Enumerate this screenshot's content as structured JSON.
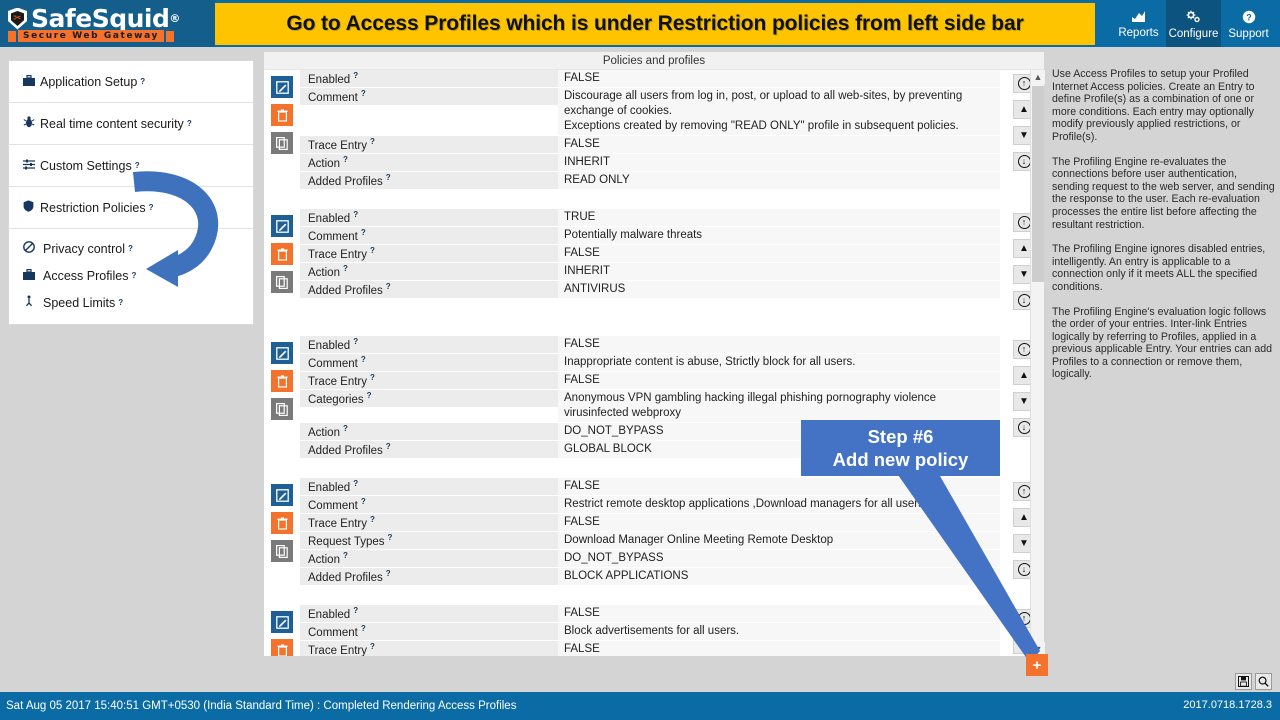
{
  "app": {
    "brand": "SafeSquid",
    "brand_reg": "®",
    "tagline": "Secure Web Gateway"
  },
  "banner": {
    "text": "Go to  Access Profiles which is under Restriction policies from left side bar",
    "bg": "#ffc400"
  },
  "topnav": [
    {
      "label": "Reports",
      "icon": "chart-icon",
      "glyph": "ὌA",
      "active": false
    },
    {
      "label": "Configure",
      "icon": "gear-icon",
      "glyph": "⚙",
      "active": true
    },
    {
      "label": "Support",
      "icon": "question-icon",
      "glyph": "❓",
      "active": false
    }
  ],
  "sidebar": {
    "items": [
      {
        "label": "Application Setup",
        "icon": "briefcase-icon",
        "glyph": "ὋC"
      },
      {
        "label": "Real time content security",
        "icon": "bug-icon",
        "glyph": "ὁE"
      },
      {
        "label": "Custom Settings",
        "icon": "sliders-icon",
        "glyph": "☲"
      },
      {
        "label": "Restriction Policies",
        "icon": "shield-icon",
        "glyph": "Ὦ1"
      }
    ],
    "subitems": [
      {
        "label": "Privacy control",
        "icon": "no-entry-icon",
        "glyph": "⃠"
      },
      {
        "label": "Access Profiles",
        "icon": "briefcase-icon",
        "glyph": "ὋC"
      },
      {
        "label": "Speed Limits",
        "icon": "gauge-icon",
        "glyph": "↧"
      }
    ],
    "help_marker": "?"
  },
  "main": {
    "header": "Policies and profiles",
    "entries": [
      {
        "rows": [
          {
            "label": "Enabled",
            "value": "FALSE"
          },
          {
            "label": "Comment",
            "value": "Discourage all users from log in, post, or upload to all web-sites, by preventing exchange of cookies.\nExceptions created by removing \"READ ONLY\" profile in subsequent policies."
          },
          {
            "label": "Trace Entry",
            "value": "FALSE"
          },
          {
            "label": "Action",
            "value": "INHERIT"
          },
          {
            "label": "Added Profiles",
            "value": "READ ONLY"
          }
        ]
      },
      {
        "rows": [
          {
            "label": "Enabled",
            "value": "TRUE"
          },
          {
            "label": "Comment",
            "value": "Potentially malware threats"
          },
          {
            "label": "Trace Entry",
            "value": "FALSE"
          },
          {
            "label": "Action",
            "value": "INHERIT"
          },
          {
            "label": "Added Profiles",
            "value": "ANTIVIRUS"
          }
        ]
      },
      {
        "rows": [
          {
            "label": "Enabled",
            "value": "FALSE"
          },
          {
            "label": "Comment",
            "value": "Inappropriate content is abuse, Strictly block for all users."
          },
          {
            "label": "Trace Entry",
            "value": "FALSE"
          },
          {
            "label": "Categories",
            "value": "Anonymous VPN  gambling  hacking  illegal  phishing  pornography  violence  virusinfected  webproxy"
          },
          {
            "label": "Action",
            "value": "DO_NOT_BYPASS"
          },
          {
            "label": "Added Profiles",
            "value": "GLOBAL BLOCK"
          }
        ]
      },
      {
        "rows": [
          {
            "label": "Enabled",
            "value": "FALSE"
          },
          {
            "label": "Comment",
            "value": "Restrict remote desktop applications ,Download managers for all users."
          },
          {
            "label": "Trace Entry",
            "value": "FALSE"
          },
          {
            "label": "Request Types",
            "value": "Download Manager  Online Meeting  Remote Desktop"
          },
          {
            "label": "Action",
            "value": "DO_NOT_BYPASS"
          },
          {
            "label": "Added Profiles",
            "value": "BLOCK APPLICATIONS"
          }
        ]
      },
      {
        "rows": [
          {
            "label": "Enabled",
            "value": "FALSE"
          },
          {
            "label": "Comment",
            "value": "Block advertisements for all users."
          },
          {
            "label": "Trace Entry",
            "value": "FALSE"
          }
        ]
      }
    ],
    "entry_actions": [
      {
        "name": "edit",
        "glyph": "✎"
      },
      {
        "name": "delete",
        "glyph": "Ὕ1"
      },
      {
        "name": "copy",
        "glyph": "⧉"
      }
    ],
    "entry_controls": [
      {
        "name": "insert-above",
        "glyph": "↑"
      },
      {
        "name": "move-up",
        "glyph": "▲"
      },
      {
        "name": "move-down",
        "glyph": "▼"
      },
      {
        "name": "insert-below",
        "glyph": "↓"
      }
    ],
    "add_button": "+"
  },
  "help": {
    "paragraphs": [
      "Use Access Profiles to setup your Profiled Internet Access policies. Create an Entry to define Profile(s) as a combination of one or more conditions. Each entry may optionally modify previously applied restrictions, or Profile(s).",
      "The Profiling Engine re-evaluates the connections before user authentication, sending request to the web server, and sending the response to the user. Each re-evaluation processes the entire list before affecting the resultant restriction.",
      "The Profiling Engine ignores disabled entries, intelligently. An entry is applicable to a connection only if it meets ALL the specified conditions.",
      "The Profiling Engine's evaluation logic follows the order of your entries. Inter-link Entries logically by referring to Profiles, applied in a previous applicable Entry. Your entries can add Profiles to a connection or remove them, logically."
    ]
  },
  "callout": {
    "line1": "Step #6",
    "line2": "Add new policy",
    "color": "#4472c4"
  },
  "statusbar": {
    "text": "Sat Aug 05 2017 15:40:51 GMT+0530 (India Standard Time) : Completed Rendering Access Profiles",
    "version": "2017.0718.1728.3",
    "icons": [
      {
        "name": "save-icon",
        "glyph": "ὋE"
      },
      {
        "name": "search-icon",
        "glyph": "ὐD"
      }
    ]
  }
}
